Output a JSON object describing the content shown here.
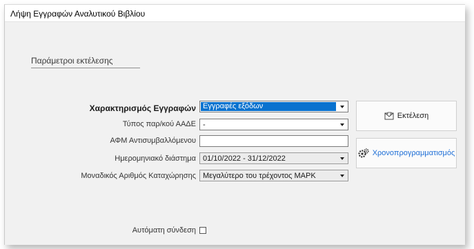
{
  "window": {
    "title": "Λήψη Εγγραφών Αναλυτικού Βιβλίου"
  },
  "section": {
    "title": "Παράμετροι εκτέλεσης"
  },
  "form": {
    "record_type": {
      "label": "Χαρακτηρισμός Εγγραφών",
      "value": "Εγγραφές εξόδων"
    },
    "aade_type": {
      "label": "Τύπος παρ/κού ΑΑΔΕ",
      "value": "-"
    },
    "counterparty_vat": {
      "label": "ΑΦΜ Αντισυμβαλλόμενου",
      "value": ""
    },
    "date_range": {
      "label": "Ημερομηνιακό διάστημα",
      "value": "01/10/2022 - 31/12/2022"
    },
    "unique_reg_number": {
      "label": "Μοναδικός Αριθμός Καταχώρησης",
      "value": "Μεγαλύτερο του τρέχοντος ΜΑΡΚ"
    },
    "auto_connect": {
      "label": "Αυτόματη σύνδεση",
      "checked": false
    }
  },
  "buttons": {
    "execute": {
      "label": "Εκτέλεση",
      "icon": "envelope-icon"
    },
    "schedule": {
      "label": "Χρονοπρογραμματισμός",
      "icon": "gears-icon"
    }
  },
  "colors": {
    "selection": "#0a72cf",
    "link": "#1d6ed6"
  }
}
